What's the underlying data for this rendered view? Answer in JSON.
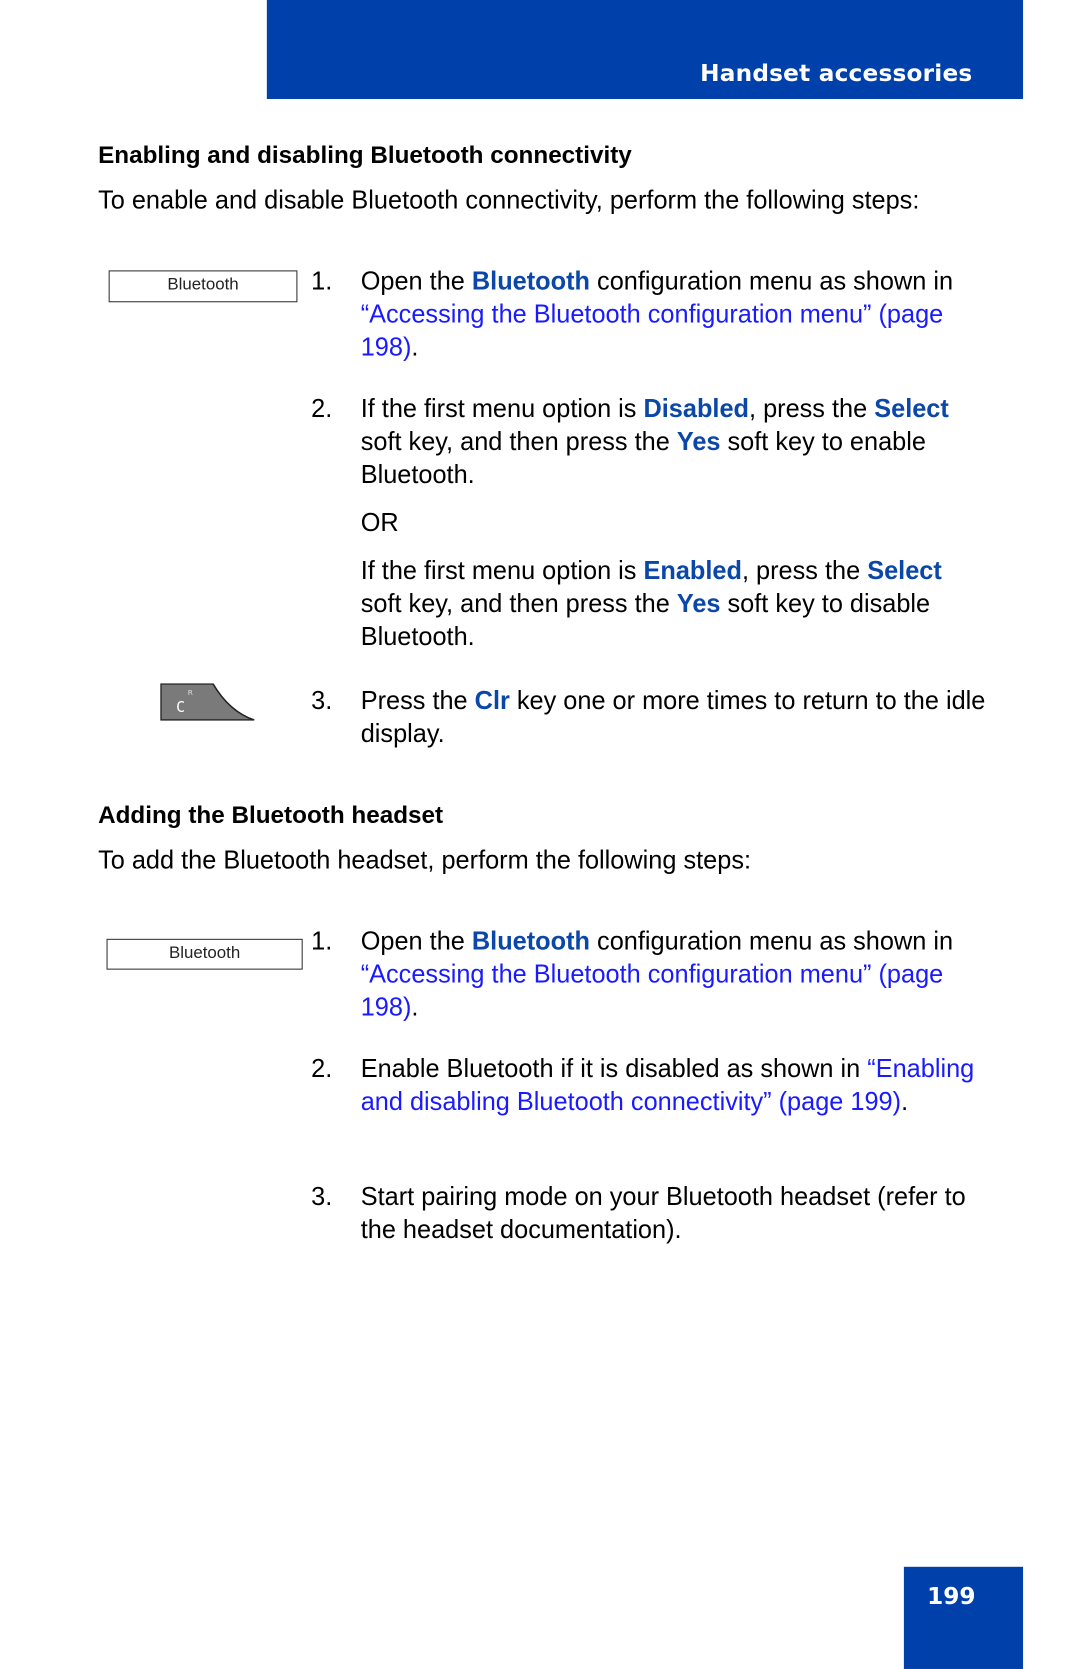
{
  "header": {
    "section_title": "Handset accessories"
  },
  "colors": {
    "brand_blue": "#0040ab",
    "keyword_blue": "#0a47a8",
    "link_blue": "#1a1aff"
  },
  "section1": {
    "heading": "Enabling and disabling Bluetooth connectivity",
    "intro": "To enable and disable Bluetooth connectivity, perform the following steps:",
    "softkey_label": "Bluetooth",
    "clr_key_icon": "clr-key-icon",
    "clr_key_glyph": "C",
    "clr_key_superscript": "R",
    "steps": [
      {
        "num": "1.",
        "t1": "Open the ",
        "k1": "Bluetooth",
        "t2": " configuration menu as shown in ",
        "link": "“Accessing the Bluetooth configuration menu” (page 198)",
        "t3": "."
      },
      {
        "num": "2.",
        "t1": "If the first menu option is ",
        "k1": "Disabled",
        "t2": ", press the ",
        "k2": "Select",
        "t3": " soft key, and then press the ",
        "k3": "Yes",
        "t4": " soft key to enable Bluetooth.",
        "or": "OR",
        "alt_t1": "If the first menu option is ",
        "alt_k1": "Enabled",
        "alt_t2": ", press the ",
        "alt_k2": "Select",
        "alt_t3": " soft key, and then press the ",
        "alt_k3": "Yes",
        "alt_t4": " soft key to disable Bluetooth."
      },
      {
        "num": "3.",
        "t1": "Press the ",
        "k1": "Clr",
        "t2": " key one or more times to return to the idle display."
      }
    ]
  },
  "section2": {
    "heading": "Adding the Bluetooth headset",
    "intro": "To add the Bluetooth headset, perform the following steps:",
    "softkey_label": "Bluetooth",
    "steps": [
      {
        "num": "1.",
        "t1": "Open the ",
        "k1": "Bluetooth",
        "t2": " configuration menu as shown in ",
        "link": "“Accessing the Bluetooth configuration menu” (page 198)",
        "t3": "."
      },
      {
        "num": "2.",
        "t1": "Enable Bluetooth if it is disabled as shown in ",
        "link": "“Enabling and disabling Bluetooth connectivity” (page 199)",
        "t2": "."
      },
      {
        "num": "3.",
        "t1": "Start pairing mode on your Bluetooth headset (refer to the headset documentation)."
      }
    ]
  },
  "footer": {
    "page_number": "199"
  }
}
